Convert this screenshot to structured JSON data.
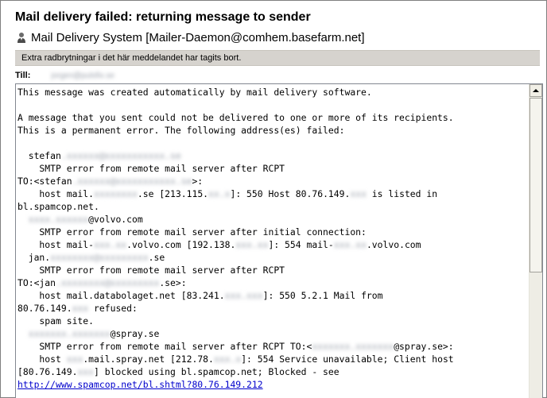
{
  "message": {
    "subject": "Mail delivery failed: returning message to sender",
    "from": "Mail Delivery System [Mailer-Daemon@comhem.basefarm.net]",
    "infobar": "Extra radbrytningar i det här meddelandet har tagits bort.",
    "to_label": "Till:",
    "to_value": "jorgen@pulsfix.se"
  },
  "body": {
    "l01": "This message was created automatically by mail delivery software.",
    "l02": "",
    "l03": "A message that you sent could not be delivered to one or more of its recipients.",
    "l04": "This is a permanent error. The following address(es) failed:",
    "l05": "",
    "l06a": "  stefan",
    "l06b": ".xxxxxx@xxxxxxxxxxx.se",
    "l07": "    SMTP error from remote mail server after RCPT",
    "l08a": "TO:<stefan",
    "l08b": ".xxxxxx@xxxxxxxxxxx.se",
    "l08c": ">:",
    "l09a": "    host mail.",
    "l09b": "xxxxxxxx",
    "l09c": ".se [213.115.",
    "l09d": "xx.x",
    "l09e": "]: 550 Host 80.76.149.",
    "l09f": "xxx",
    "l09g": " is listed in",
    "l10": "bl.spamcop.net.",
    "l11a": "  ",
    "l11b": "xxxx.xxxxxx",
    "l11c": "@volvo.com",
    "l12": "    SMTP error from remote mail server after initial connection:",
    "l13a": "    host mail-",
    "l13b": "xxx.xx",
    "l13c": ".volvo.com [192.138.",
    "l13d": "xxx.xx",
    "l13e": "]: 554 mail-",
    "l13f": "xxx.xx",
    "l13g": ".volvo.com",
    "l14a": "  jan.",
    "l14b": "xxxxxxxx@xxxxxxxxx",
    "l14c": ".se",
    "l15": "    SMTP error from remote mail server after RCPT",
    "l16a": "TO:<jan",
    "l16b": ".xxxxxxxx@xxxxxxxxx",
    "l16c": ".se>:",
    "l17a": "    host mail.databolaget.net [83.241.",
    "l17b": "xxx.xxx",
    "l17c": "]: 550 5.2.1 Mail from",
    "l18a": "80.76.149.",
    "l18b": "xxx",
    "l18c": " refused:",
    "l19": "    spam site.",
    "l20a": "  ",
    "l20b": "xxxxxxx.xxxxxxx",
    "l20c": "@spray.se",
    "l21a": "    SMTP error from remote mail server after RCPT TO:<",
    "l21b": "xxxxxxx.xxxxxxx",
    "l21c": "@spray.se>:",
    "l22a": "    host ",
    "l22b": "xxx",
    "l22c": ".mail.spray.net [212.78.",
    "l22d": "xxx.x",
    "l22e": "]: 554 Service unavailable; Client host",
    "l23a": "[80.76.149.",
    "l23b": "xxx",
    "l23c": "] blocked using bl.spamcop.net; Blocked - see",
    "link": "http://www.spamcop.net/bl.shtml?80.76.149.212"
  },
  "icons": {
    "sender": "person-icon",
    "scroll_up": "arrow-up-icon"
  },
  "colors": {
    "infobar_bg": "#d6d3ce",
    "link": "#0000cc",
    "scrollbar_bg": "#eeede5"
  }
}
